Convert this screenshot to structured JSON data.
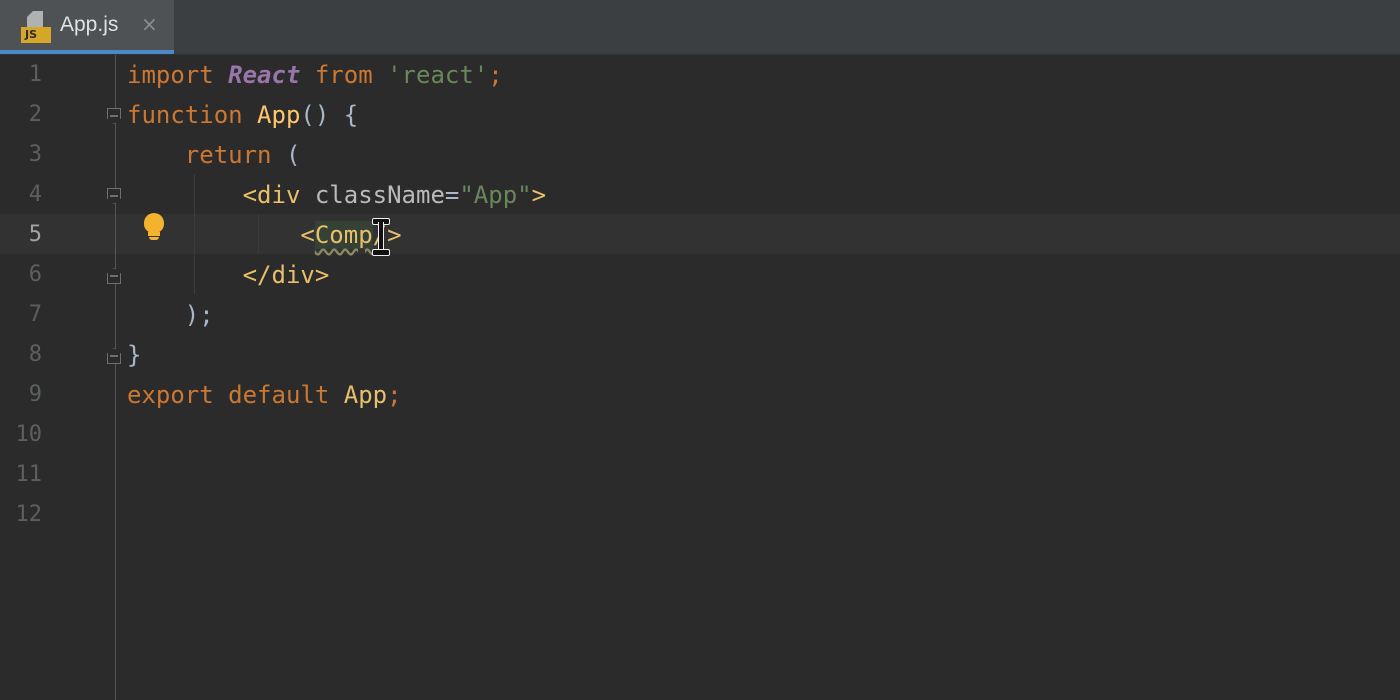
{
  "tab": {
    "filename": "App.js",
    "icon": "javascript-file-icon",
    "badge": "JS",
    "close_glyph": "×"
  },
  "colors": {
    "background": "#2b2b2b",
    "keyword": "#cc7832",
    "string": "#6a8759",
    "tag": "#e8bf6a",
    "function": "#ffc66d",
    "react": "#9876aa",
    "bulb": "#f4b32c"
  },
  "editor": {
    "current_line": 5,
    "lines": [
      {
        "number": "1",
        "tokens": [
          [
            "kw",
            "import"
          ],
          [
            "plain",
            " "
          ],
          [
            "react",
            "React"
          ],
          [
            "plain",
            " "
          ],
          [
            "kw",
            "from"
          ],
          [
            "plain",
            " "
          ],
          [
            "str",
            "'react'"
          ],
          [
            "kw",
            ";"
          ]
        ]
      },
      {
        "number": "2",
        "tokens": [
          [
            "kw",
            "function"
          ],
          [
            "plain",
            " "
          ],
          [
            "fn",
            "App"
          ],
          [
            "plain",
            "() {"
          ]
        ]
      },
      {
        "number": "3",
        "tokens": [
          [
            "plain",
            "    "
          ],
          [
            "kw",
            "return"
          ],
          [
            "plain",
            " ("
          ]
        ]
      },
      {
        "number": "4",
        "tokens": [
          [
            "plain",
            "        "
          ],
          [
            "tag",
            "<div"
          ],
          [
            "plain",
            " "
          ],
          [
            "attr",
            "className"
          ],
          [
            "plain",
            "="
          ],
          [
            "str",
            "\"App\""
          ],
          [
            "tag",
            ">"
          ]
        ]
      },
      {
        "number": "5",
        "tokens": [
          [
            "plain",
            "            "
          ],
          [
            "tag",
            "<"
          ],
          [
            "comp",
            "Comp"
          ],
          [
            "tag",
            "/>"
          ]
        ]
      },
      {
        "number": "6",
        "tokens": [
          [
            "plain",
            "        "
          ],
          [
            "tag",
            "</div>"
          ]
        ]
      },
      {
        "number": "7",
        "tokens": [
          [
            "plain",
            "    );"
          ]
        ]
      },
      {
        "number": "8",
        "tokens": [
          [
            "plain",
            "}"
          ]
        ]
      },
      {
        "number": "9",
        "tokens": [
          [
            "kw",
            "export"
          ],
          [
            "plain",
            " "
          ],
          [
            "kw",
            "default"
          ],
          [
            "plain",
            " "
          ],
          [
            "ident",
            "App"
          ],
          [
            "kw",
            ";"
          ]
        ]
      },
      {
        "number": "10",
        "tokens": []
      },
      {
        "number": "11",
        "tokens": []
      },
      {
        "number": "12",
        "tokens": []
      }
    ]
  }
}
